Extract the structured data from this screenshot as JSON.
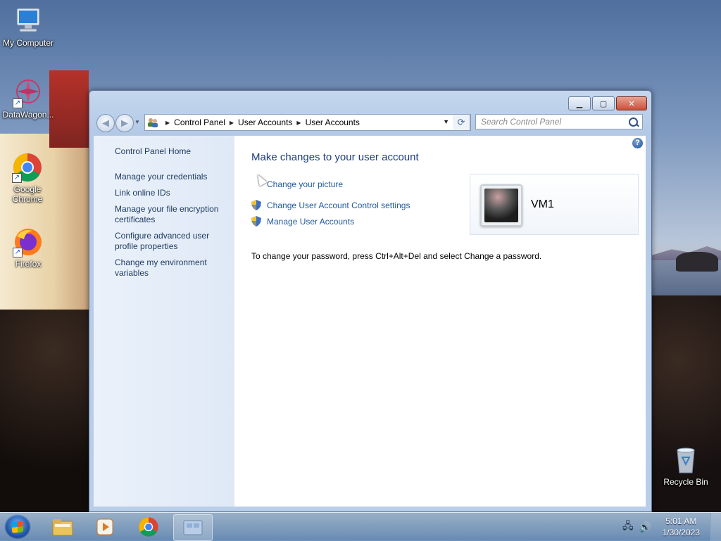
{
  "desktop": {
    "icons": [
      {
        "label": "My Computer"
      },
      {
        "label": "DataWagon..."
      },
      {
        "label": "Google Chrome"
      },
      {
        "label": "Firefox"
      },
      {
        "label": "Recycle Bin"
      }
    ]
  },
  "window": {
    "address": {
      "crumbs": [
        "Control Panel",
        "User Accounts",
        "User Accounts"
      ]
    },
    "search": {
      "placeholder": "Search Control Panel"
    },
    "left_pane": {
      "home": "Control Panel Home",
      "links": [
        "Manage your credentials",
        "Link online IDs",
        "Manage your file encryption certificates",
        "Configure advanced user profile properties",
        "Change my environment variables"
      ]
    },
    "main": {
      "heading": "Make changes to your user account",
      "tasks": [
        "Change your picture",
        "Change User Account Control settings",
        "Manage User Accounts"
      ],
      "note": "To change your password, press Ctrl+Alt+Del and select Change a password.",
      "user": {
        "name": "VM1"
      }
    }
  },
  "taskbar": {
    "clock": {
      "time": "5:01 AM",
      "date": "1/30/2023"
    }
  },
  "colors": {
    "link": "#1f5a9e",
    "heading": "#1e3d7a",
    "left_link": "#1e3a5f"
  }
}
